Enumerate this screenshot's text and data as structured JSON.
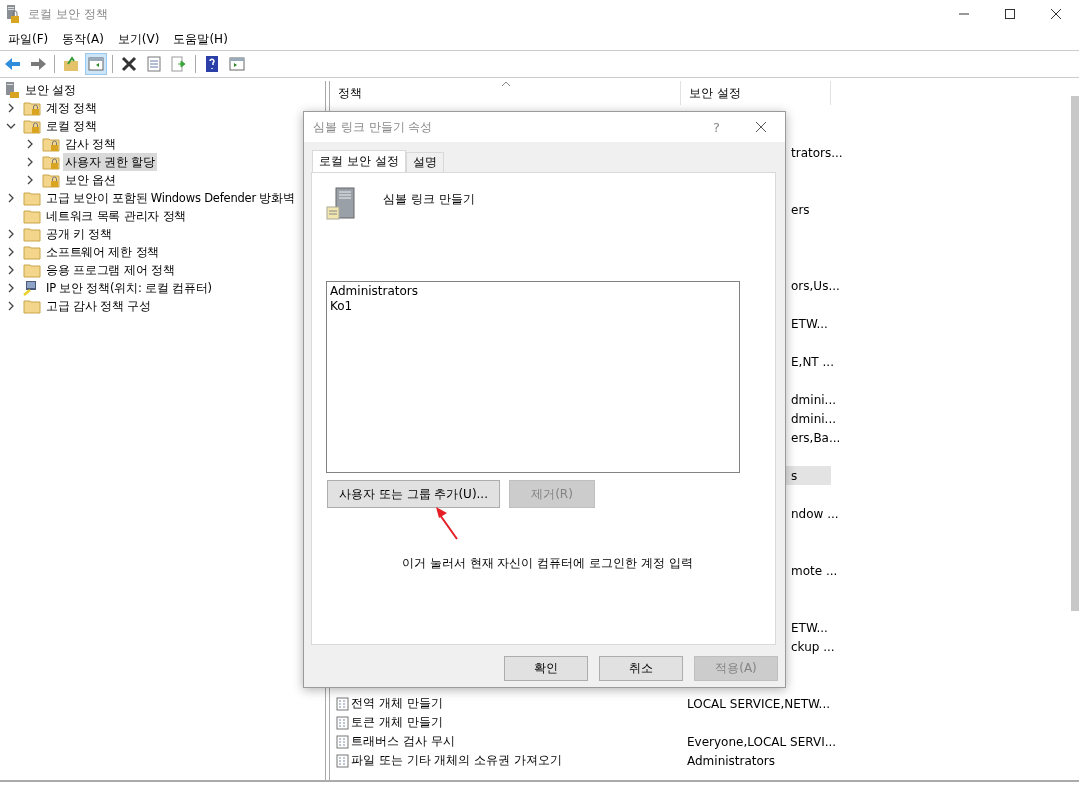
{
  "window": {
    "title": "로컬 보안 정책"
  },
  "menu": [
    "파일(F)",
    "동작(A)",
    "보기(V)",
    "도움말(H)"
  ],
  "toolbar": [
    {
      "kind": "back",
      "pressed": false
    },
    {
      "kind": "forward",
      "pressed": false
    },
    {
      "kind": "sep"
    },
    {
      "kind": "up",
      "pressed": false
    },
    {
      "kind": "tree",
      "pressed": true
    },
    {
      "kind": "sep"
    },
    {
      "kind": "delete",
      "pressed": false
    },
    {
      "kind": "properties",
      "pressed": false
    },
    {
      "kind": "export",
      "pressed": false
    },
    {
      "kind": "sep"
    },
    {
      "kind": "help",
      "pressed": false
    },
    {
      "kind": "pane",
      "pressed": false
    }
  ],
  "tree": [
    {
      "label": "보안 설정",
      "kind": "root",
      "selected": false,
      "children": [
        {
          "label": "계정 정책",
          "kind": "lock",
          "expanded": false,
          "selected": false
        },
        {
          "label": "로컬 정책",
          "kind": "lock",
          "expanded": true,
          "selected": false,
          "children": [
            {
              "label": "감사 정책",
              "kind": "lock",
              "expanded": false,
              "selected": false
            },
            {
              "label": "사용자 권한 할당",
              "kind": "lock",
              "expanded": false,
              "selected": true
            },
            {
              "label": "보안 옵션",
              "kind": "lock",
              "expanded": false,
              "selected": false
            }
          ]
        },
        {
          "label": "고급 보안이 포함된 Windows Defender 방화벽",
          "kind": "folder",
          "expanded": false,
          "selected": false
        },
        {
          "label": "네트워크 목록 관리자 정책",
          "kind": "folder",
          "selected": false
        },
        {
          "label": "공개 키 정책",
          "kind": "folder",
          "expanded": false,
          "selected": false
        },
        {
          "label": "소프트웨어 제한 정책",
          "kind": "folder",
          "expanded": false,
          "selected": false
        },
        {
          "label": "응용 프로그램 제어 정책",
          "kind": "folder",
          "expanded": false,
          "selected": false
        },
        {
          "label": "IP 보안 정책(위치: 로컬 컴퓨터)",
          "kind": "ip",
          "expanded": false,
          "selected": false
        },
        {
          "label": "고급 감사 정책 구성",
          "kind": "folder",
          "expanded": false,
          "selected": false
        }
      ]
    }
  ],
  "list": {
    "columns": [
      "정책",
      "보안 설정"
    ],
    "rows": [
      {
        "kind": "blank",
        "selected": false
      },
      {
        "kind": "blank",
        "selected": false
      },
      {
        "kind": "covered",
        "setting": "trators...",
        "selected": false
      },
      {
        "kind": "blank",
        "selected": false
      },
      {
        "kind": "blank",
        "selected": false
      },
      {
        "kind": "covered",
        "setting": "ers",
        "selected": false
      },
      {
        "kind": "blank",
        "selected": false
      },
      {
        "kind": "blank",
        "selected": false
      },
      {
        "kind": "blank",
        "selected": false
      },
      {
        "kind": "covered",
        "setting": "ors,Us...",
        "selected": false
      },
      {
        "kind": "blank",
        "selected": false
      },
      {
        "kind": "covered",
        "setting": "ETW...",
        "selected": false
      },
      {
        "kind": "blank",
        "selected": false
      },
      {
        "kind": "covered",
        "setting": "E,NT ...",
        "selected": false
      },
      {
        "kind": "blank",
        "selected": false
      },
      {
        "kind": "covered",
        "setting": "dmini...",
        "selected": false
      },
      {
        "kind": "covered",
        "setting": "dmini...",
        "selected": false
      },
      {
        "kind": "covered",
        "setting": "ers,Ba...",
        "selected": false
      },
      {
        "kind": "blank",
        "selected": false
      },
      {
        "kind": "covered",
        "setting": "s",
        "selected": true
      },
      {
        "kind": "blank",
        "selected": false
      },
      {
        "kind": "covered",
        "setting": "ndow ...",
        "selected": false
      },
      {
        "kind": "blank",
        "selected": false
      },
      {
        "kind": "blank",
        "selected": false
      },
      {
        "kind": "covered",
        "setting": "mote ...",
        "selected": false
      },
      {
        "kind": "blank",
        "selected": false
      },
      {
        "kind": "blank",
        "selected": false
      },
      {
        "kind": "covered",
        "setting": "ETW...",
        "selected": false
      },
      {
        "kind": "covered",
        "setting": "ckup ...",
        "selected": false
      },
      {
        "kind": "blank",
        "selected": false
      },
      {
        "kind": "blank",
        "selected": false
      },
      {
        "kind": "full",
        "policy": "전역 개체 만들기",
        "setting": "LOCAL SERVICE,NETW...",
        "selected": false
      },
      {
        "kind": "full",
        "policy": "토큰 개체 만들기",
        "selected": false
      },
      {
        "kind": "full",
        "policy": "트래버스 검사 무시",
        "setting": "Everyone,LOCAL SERVI...",
        "selected": false
      },
      {
        "kind": "full",
        "policy": "파일 또는 기타 개체의 소유권 가져오기",
        "setting": "Administrators",
        "selected": false
      }
    ]
  },
  "dialog": {
    "title": "심볼 링크 만들기 속성",
    "help": "?",
    "tabs": [
      {
        "label": "로컬 보안 설정",
        "selected": true
      },
      {
        "label": "설명",
        "selected": false
      }
    ],
    "policy_name": "심볼 링크 만들기",
    "members": [
      "Administrators",
      "Ko1"
    ],
    "actions": [
      {
        "label": "사용자 또는 그룹 추가(U)...",
        "disabled": false
      },
      {
        "label": "제거(R)",
        "disabled": true
      }
    ],
    "annotation": "이거 눌러서 현재 자신이 컴퓨터에 로그인한 계정 입력",
    "buttons": [
      {
        "label": "확인",
        "disabled": false
      },
      {
        "label": "취소",
        "disabled": false
      },
      {
        "label": "적용(A)",
        "disabled": true
      }
    ]
  }
}
